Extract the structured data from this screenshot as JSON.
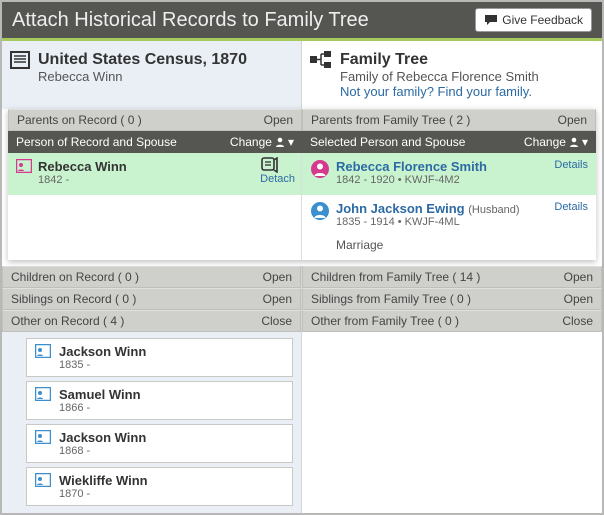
{
  "topbar": {
    "title": "Attach Historical Records to Family Tree",
    "feedback": "Give Feedback"
  },
  "left": {
    "source_title": "United States Census, 1870",
    "source_person": "Rebecca Winn"
  },
  "right": {
    "tree_title": "Family Tree",
    "tree_sub": "Family of Rebecca Florence Smith",
    "find_prompt": "Not your family? Find your family."
  },
  "sections": {
    "parents_record": "Parents on Record  ( 0 )",
    "parents_tree": "Parents from Family Tree  ( 2 )",
    "open": "Open",
    "close": "Close",
    "person_record": "Person of Record and Spouse",
    "selected_tree": "Selected Person and Spouse",
    "change": "Change",
    "children_record": "Children on Record  ( 0 )",
    "children_tree": "Children from Family Tree  ( 14 )",
    "siblings_record": "Siblings on Record  ( 0 )",
    "siblings_tree": "Siblings from Family Tree  ( 0 )",
    "other_record": "Other on Record  ( 4 )",
    "other_tree": "Other from Family Tree  ( 0 )"
  },
  "record_person": {
    "name": "Rebecca Winn",
    "meta": "1842 -",
    "detach": "Detach"
  },
  "tree_person": {
    "name": "Rebecca Florence Smith",
    "meta": "1842 - 1920 • KWJF-4M2",
    "details": "Details"
  },
  "tree_spouse": {
    "name": "John Jackson Ewing",
    "rel": "(Husband)",
    "meta": "1835 - 1914 • KWJF-4ML",
    "marriage": "Marriage",
    "details": "Details"
  },
  "others": [
    {
      "name": "Jackson Winn",
      "meta": "1835 -"
    },
    {
      "name": "Samuel Winn",
      "meta": "1866 -"
    },
    {
      "name": "Jackson Winn",
      "meta": "1868 -"
    },
    {
      "name": "Wiekliffe Winn",
      "meta": "1870 -"
    }
  ]
}
